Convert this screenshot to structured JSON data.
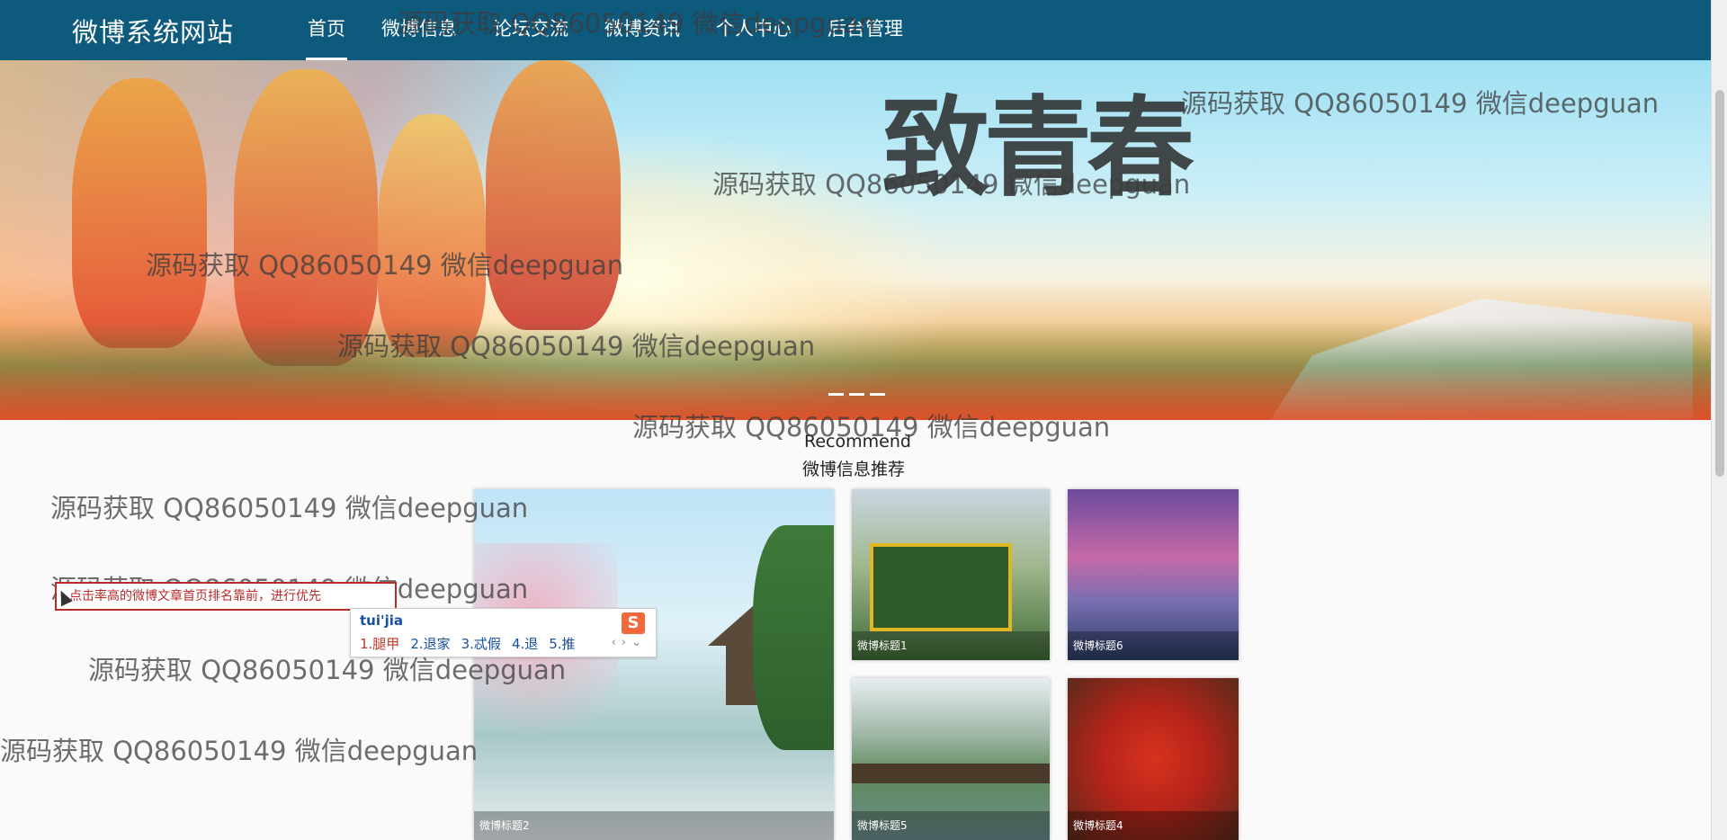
{
  "header": {
    "brand": "微博系统网站",
    "nav": [
      "首页",
      "微博信息",
      "论坛交流",
      "微博资讯",
      "个人中心",
      "后台管理"
    ],
    "active_index": 0
  },
  "banner": {
    "calligraphy": "致青春",
    "slide_indicators": 3
  },
  "section": {
    "title_en": "Recommend",
    "title_cn": "微博信息推荐"
  },
  "cards": [
    {
      "title": "微博标题2"
    },
    {
      "title": "微博标题1"
    },
    {
      "title": "微博标题6"
    },
    {
      "title": "微博标题5"
    },
    {
      "title": "微博标题4"
    }
  ],
  "tooltip": {
    "text": "点击率高的微博文章首页排名靠前，进行优先"
  },
  "ime": {
    "composition": "tui'jia",
    "candidates": [
      "1.腿甲",
      "2.退家",
      "3.忒假",
      "4.退",
      "5.推"
    ],
    "logo": "S"
  },
  "watermark": {
    "text": "源码获取 QQ86050149 微信deepguan"
  },
  "colors": {
    "navbar": "#0d5a7c",
    "tooltip_border": "#b72b2b",
    "ime_text": "#1a4fa0"
  }
}
